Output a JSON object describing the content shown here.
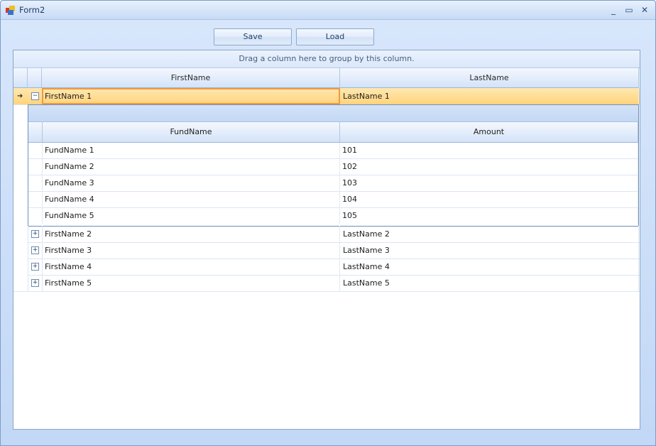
{
  "window": {
    "title": "Form2",
    "icons": {
      "app": "form-app-icon",
      "minimize": "minimize-icon",
      "maximize": "maximize-icon",
      "close": "close-icon"
    }
  },
  "toolbar": {
    "save_label": "Save",
    "load_label": "Load"
  },
  "grid": {
    "group_panel_text": "Drag a column here to group by this column.",
    "columns": [
      "FirstName",
      "LastName"
    ],
    "rows": [
      {
        "first": "FirstName 1",
        "last": "LastName 1",
        "expanded": true,
        "selected": true
      },
      {
        "first": "FirstName 2",
        "last": "LastName 2",
        "expanded": false
      },
      {
        "first": "FirstName 3",
        "last": "LastName 3",
        "expanded": false
      },
      {
        "first": "FirstName 4",
        "last": "LastName 4",
        "expanded": false
      },
      {
        "first": "FirstName 5",
        "last": "LastName 5",
        "expanded": false
      }
    ],
    "detail": {
      "columns": [
        "FundName",
        "Amount"
      ],
      "rows": [
        {
          "fund": "FundName 1",
          "amount": "101"
        },
        {
          "fund": "FundName 2",
          "amount": "102"
        },
        {
          "fund": "FundName 3",
          "amount": "103"
        },
        {
          "fund": "FundName 4",
          "amount": "104"
        },
        {
          "fund": "FundName 5",
          "amount": "105"
        }
      ]
    },
    "expand_glyph": "⊞",
    "collapse_glyph": "⊟",
    "current_row_glyph": "➜"
  },
  "colors": {
    "selection": "#ffd37c",
    "focus_border": "#f29a3c",
    "form_background": "#c4daf6"
  }
}
